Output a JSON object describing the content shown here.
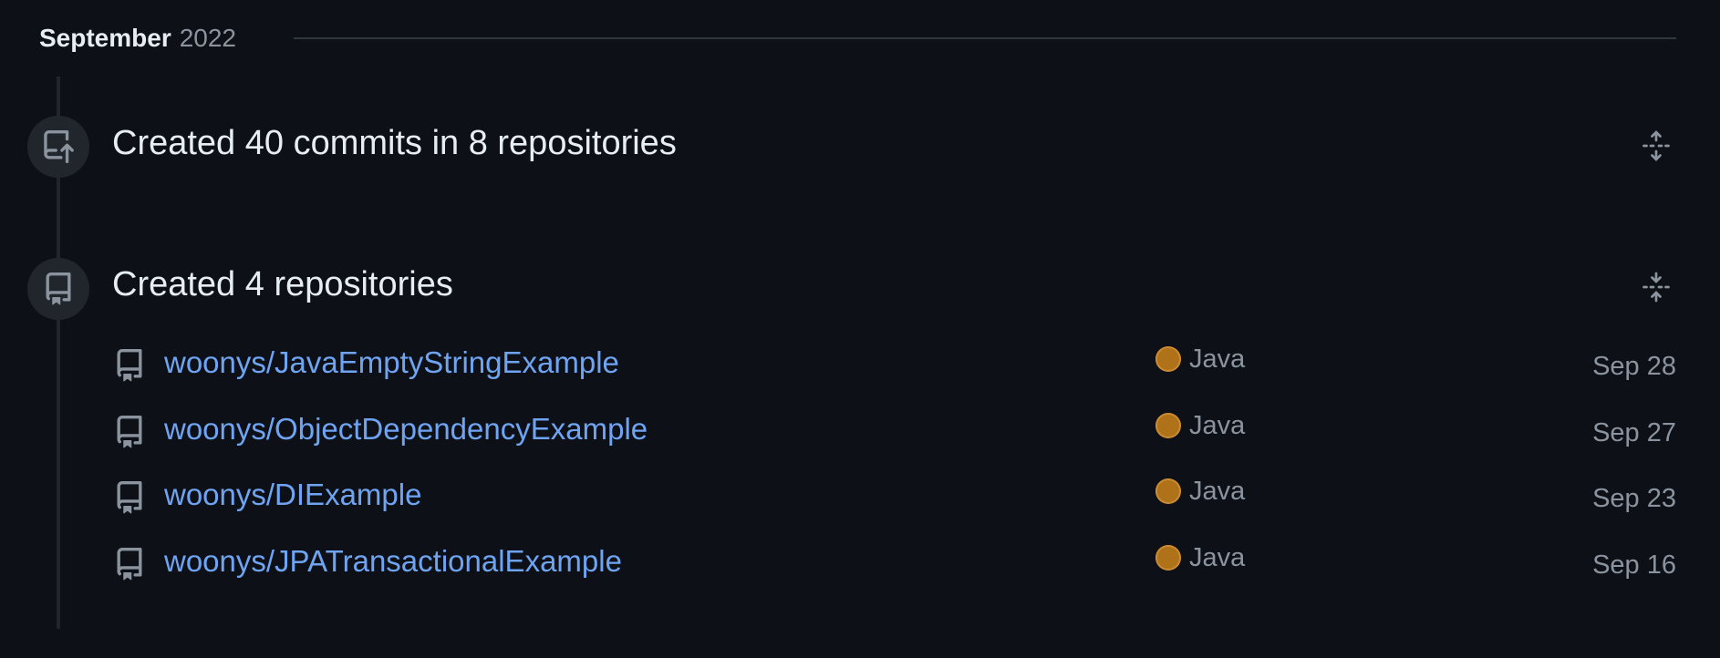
{
  "month": {
    "name": "September",
    "year": "2022"
  },
  "sections": [
    {
      "title": "Created 40 commits in 8 repositories",
      "icon": "repo-push-icon",
      "fold_icon": "unfold-icon"
    },
    {
      "title": "Created 4 repositories",
      "icon": "repo-icon",
      "fold_icon": "fold-icon"
    }
  ],
  "repos": [
    {
      "name": "woonys/JavaEmptyStringExample",
      "language": "Java",
      "date": "Sep 28"
    },
    {
      "name": "woonys/ObjectDependencyExample",
      "language": "Java",
      "date": "Sep 27"
    },
    {
      "name": "woonys/DIExample",
      "language": "Java",
      "date": "Sep 23"
    },
    {
      "name": "woonys/JPATransactionalExample",
      "language": "Java",
      "date": "Sep 16"
    }
  ],
  "colors": {
    "background": "#0d1117",
    "link": "#6fa4f2",
    "java": "#b07219",
    "muted": "#8b949e"
  }
}
